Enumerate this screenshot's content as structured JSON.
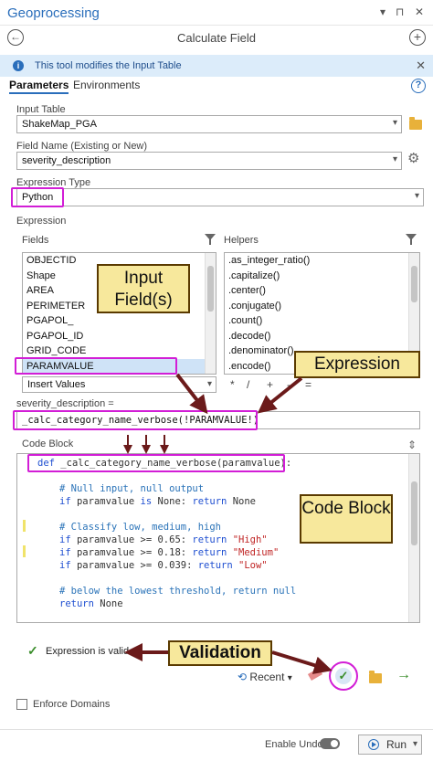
{
  "window": {
    "title": "Geoprocessing",
    "dropdown_icon": "▾",
    "pin_icon": "⊓",
    "close_icon": "✕"
  },
  "header": {
    "tool_title": "Calculate Field",
    "back_icon": "←",
    "add_icon": "+"
  },
  "banner": {
    "message": "This tool modifies the Input Table",
    "info_glyph": "i",
    "close_icon": "✕"
  },
  "tabs": [
    {
      "label": "Parameters",
      "active": true
    },
    {
      "label": "Environments",
      "active": false
    }
  ],
  "help_glyph": "?",
  "params": {
    "input_table_label": "Input Table",
    "input_table_value": "ShakeMap_PGA",
    "field_name_label": "Field Name (Existing or New)",
    "field_name_value": "severity_description",
    "expression_type_label": "Expression Type",
    "expression_type_value": "Python",
    "expression_label": "Expression",
    "fields_label": "Fields",
    "helpers_label": "Helpers"
  },
  "fields": [
    "OBJECTID",
    "Shape",
    "AREA",
    "PERIMETER",
    "PGAPOL_",
    "PGAPOL_ID",
    "GRID_CODE",
    "PARAMVALUE"
  ],
  "helpers": [
    ".as_integer_ratio()",
    ".capitalize()",
    ".center()",
    ".conjugate()",
    ".count()",
    ".decode()",
    ".denominator()",
    ".encode()"
  ],
  "insert_values_label": "Insert Values",
  "operators": [
    "*",
    "/",
    "+",
    "-",
    "="
  ],
  "expression": {
    "target_label": "severity_description =",
    "value": "_calc_category_name_verbose(!PARAMVALUE!)"
  },
  "code_block": {
    "label": "Code Block",
    "line1": {
      "kw": "def ",
      "rest": "_calc_category_name_verbose(paramvalue):"
    },
    "c1": "# Null input, null output",
    "l2a": "if",
    "l2b": " paramvalue ",
    "l2c": "is",
    "l2d": " None: ",
    "l2e": "return",
    "l2f": " None",
    "c2": "# Classify low, medium, high",
    "l3a": "if",
    "l3b": " paramvalue >= 0.65: ",
    "l3c": "return",
    "l3d": "\"High\"",
    "l4a": "if",
    "l4b": " paramvalue >= 0.18: ",
    "l4c": "return",
    "l4d": "\"Medium\"",
    "l5a": "if",
    "l5b": " paramvalue >= 0.039: ",
    "l5c": "return",
    "l5d": "\"Low\"",
    "c3": "# below the lowest threshold, return null",
    "l6a": "return",
    "l6b": " None"
  },
  "validation_message": "Expression is valid",
  "recent_label": "Recent",
  "enforce_domains_label": "Enforce Domains",
  "enable_undo_label": "Enable Undo",
  "run_label": "Run",
  "callouts": {
    "input_fields": "Input Field(s)",
    "expression": "Expression",
    "code_block": "Code Block",
    "validation": "Validation"
  },
  "colors": {
    "accent": "#2a6ebb",
    "highlight": "#d21ed6",
    "callout_bg": "#f7e89c",
    "annotation_arrow": "#6b1a1a",
    "valid_green": "#3a8d2a"
  }
}
